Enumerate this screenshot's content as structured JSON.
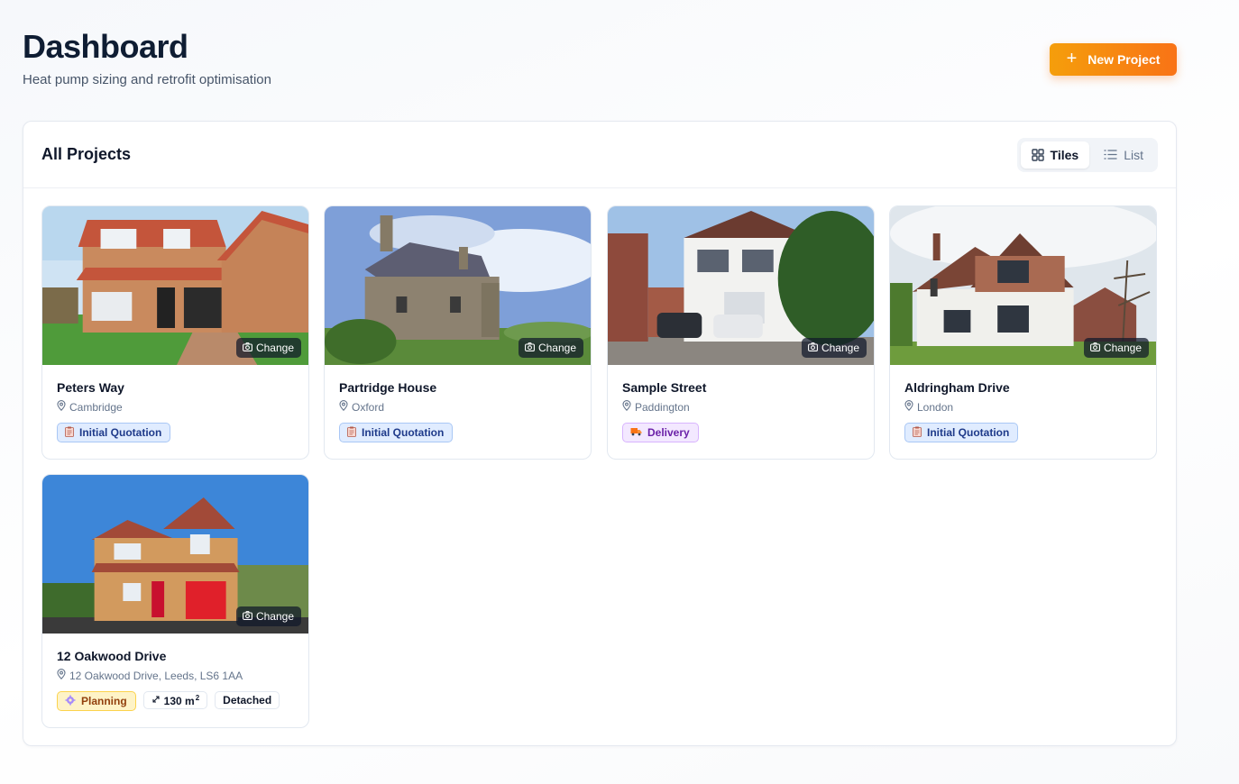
{
  "header": {
    "title": "Dashboard",
    "subtitle": "Heat pump sizing and retrofit optimisation",
    "new_project_label": "New Project"
  },
  "panel": {
    "title": "All Projects",
    "view_toggle": {
      "tiles_label": "Tiles",
      "list_label": "List",
      "selected": "Tiles"
    }
  },
  "change_label": "Change",
  "projects": [
    {
      "name": "Peters Way",
      "location": "Cambridge",
      "status": "Initial Quotation",
      "status_icon": "clipboard-icon"
    },
    {
      "name": "Partridge House",
      "location": "Oxford",
      "status": "Initial Quotation",
      "status_icon": "clipboard-icon"
    },
    {
      "name": "Sample Street",
      "location": "Paddington",
      "status": "Delivery",
      "status_icon": "truck-icon"
    },
    {
      "name": "Aldringham Drive",
      "location": "London",
      "status": "Initial Quotation",
      "status_icon": "clipboard-icon"
    },
    {
      "name": "12 Oakwood Drive",
      "location": "12 Oakwood Drive, Leeds, LS6 1AA",
      "status": "Planning",
      "status_icon": "gear-icon",
      "area_value": "130 m",
      "area_unit_sup": "2",
      "property_type": "Detached"
    }
  ],
  "colors": {
    "accent_start": "#f59e0b",
    "accent_end": "#f97316",
    "quote_badge": "#e0ecff",
    "delivery_badge": "#f3e8ff",
    "planning_badge": "#fef3c7"
  }
}
